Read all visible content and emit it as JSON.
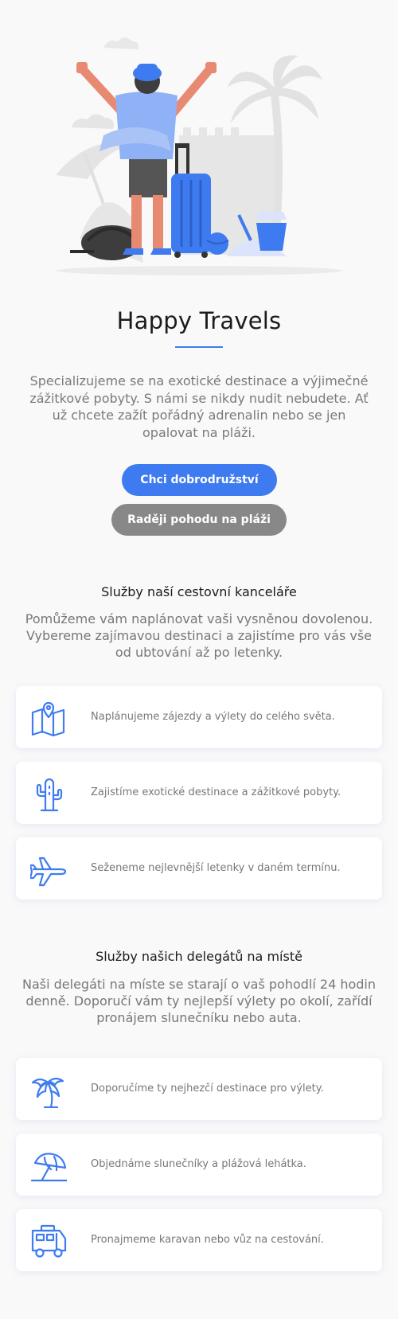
{
  "hero": {
    "title": "Happy Travels",
    "description": "Specializujeme se na exotické destinace a výjimečné zážitkové pobyty. S námi se nikdy nudit nebudete. Ať už chcete zažít pořádný adrenalin nebo se jen opalovat na pláži.",
    "primary_button": "Chci dobrodružství",
    "secondary_button": "Raději pohodu na pláži"
  },
  "agency_services": {
    "title": "Služby naší cestovní kanceláře",
    "text": "Pomůžeme vám naplánovat vaši vysněnou dovolenou. Vybereme zajímavou destinaci a zajistíme pro vás vše od ubtování až po letenky.",
    "items": [
      {
        "icon": "map-pin-icon",
        "label": "Naplánujeme zájezdy a výlety do celého světa."
      },
      {
        "icon": "cactus-icon",
        "label": "Zajistíme exotické destinace a zážitkové pobyty."
      },
      {
        "icon": "airplane-icon",
        "label": "Seženeme nejlevnější letenky v daném termínu."
      }
    ]
  },
  "delegate_services": {
    "title": "Služby našich delegátů na místě",
    "text": "Naši delegáti na míste se starají o vaš pohodlí 24 hodin denně. Doporučí vám ty nejlepší výlety po okolí, zařídí pronájem slunečníku nebo auta.",
    "items": [
      {
        "icon": "palm-tree-icon",
        "label": "Doporučíme ty nejhezčí destinace pro výlety."
      },
      {
        "icon": "beach-umbrella-icon",
        "label": "Objednáme slunečníky a plážová lehátka."
      },
      {
        "icon": "camper-van-icon",
        "label": "Pronajmeme karavan nebo vůz na cestování."
      }
    ]
  },
  "colors": {
    "accent": "#3f7bf0",
    "secondary_button": "#888888",
    "background": "#f9f9fa",
    "icon": "#3f7cf0"
  }
}
